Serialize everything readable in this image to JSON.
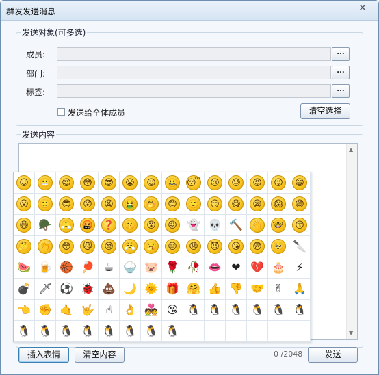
{
  "window": {
    "title": "群发发送消息",
    "close_glyph": "✕"
  },
  "recipients": {
    "group_title": "发送对象(可多选)",
    "members_label": "成员:",
    "departments_label": "部门:",
    "tags_label": "标签:",
    "browse_label": "...",
    "send_all_label": "发送给全体成员",
    "send_all_checked": false,
    "clear_selection_label": "清空选择"
  },
  "content": {
    "group_title": "发送内容",
    "value": ""
  },
  "emoji_panel": {
    "items": [
      {
        "name": "smile-emoji",
        "kind": "smiley",
        "glyph": "☺"
      },
      {
        "name": "grimace-emoji",
        "kind": "smiley",
        "glyph": "😬"
      },
      {
        "name": "heart-eyes-emoji",
        "kind": "smiley",
        "glyph": "😍"
      },
      {
        "name": "stare-emoji",
        "kind": "smiley",
        "glyph": "😳"
      },
      {
        "name": "sunglasses-emoji",
        "kind": "smiley",
        "glyph": "😎"
      },
      {
        "name": "cry-emoji",
        "kind": "smiley",
        "glyph": "😭"
      },
      {
        "name": "shy-emoji",
        "kind": "smiley",
        "glyph": "☺"
      },
      {
        "name": "shut-up-emoji",
        "kind": "smiley",
        "glyph": "🤐"
      },
      {
        "name": "sleep-emoji",
        "kind": "smiley",
        "glyph": "😴"
      },
      {
        "name": "tears-emoji",
        "kind": "smiley",
        "glyph": "😢"
      },
      {
        "name": "awkward-emoji",
        "kind": "smiley",
        "glyph": "😓"
      },
      {
        "name": "angry-emoji",
        "kind": "smiley",
        "glyph": "😡"
      },
      {
        "name": "tongue-emoji",
        "kind": "smiley",
        "glyph": "😜"
      },
      {
        "name": "grin-emoji",
        "kind": "smiley",
        "glyph": "😁"
      },
      {
        "name": "surprise-emoji",
        "kind": "smiley",
        "glyph": "😮"
      },
      {
        "name": "sad-emoji",
        "kind": "smiley",
        "glyph": "🙁"
      },
      {
        "name": "cool-emoji",
        "kind": "smiley",
        "glyph": "😎"
      },
      {
        "name": "cold-sweat-emoji",
        "kind": "smiley",
        "glyph": "😰"
      },
      {
        "name": "crazy-emoji",
        "kind": "smiley",
        "glyph": "😫"
      },
      {
        "name": "vomit-emoji",
        "kind": "smiley",
        "glyph": "🤮"
      },
      {
        "name": "chuckle-emoji",
        "kind": "smiley",
        "glyph": "🤭"
      },
      {
        "name": "joyful-emoji",
        "kind": "smiley",
        "glyph": "😊"
      },
      {
        "name": "slight-emoji",
        "kind": "smiley",
        "glyph": "🙂"
      },
      {
        "name": "proud-emoji",
        "kind": "smiley",
        "glyph": "😏"
      },
      {
        "name": "hungry-emoji",
        "kind": "smiley",
        "glyph": "😋"
      },
      {
        "name": "drowsy-emoji",
        "kind": "smiley",
        "glyph": "😪"
      },
      {
        "name": "panic-emoji",
        "kind": "smiley",
        "glyph": "😱"
      },
      {
        "name": "sweat-emoji",
        "kind": "smiley",
        "glyph": "😅"
      },
      {
        "name": "laugh-emoji",
        "kind": "smiley",
        "glyph": "😄"
      },
      {
        "name": "soldier-emoji",
        "kind": "obj",
        "glyph": "🪖"
      },
      {
        "name": "strive-emoji",
        "kind": "smiley",
        "glyph": "😤"
      },
      {
        "name": "curse-emoji",
        "kind": "smiley",
        "glyph": "🤬"
      },
      {
        "name": "question-emoji",
        "kind": "smiley",
        "glyph": "❓"
      },
      {
        "name": "shh-emoji",
        "kind": "smiley",
        "glyph": "🤫"
      },
      {
        "name": "dizzy-emoji",
        "kind": "smiley",
        "glyph": "😵"
      },
      {
        "name": "tormented-emoji",
        "kind": "smiley",
        "glyph": "😖"
      },
      {
        "name": "skeleton-emoji",
        "kind": "obj",
        "glyph": "👻"
      },
      {
        "name": "skull-emoji",
        "kind": "obj",
        "glyph": "💀"
      },
      {
        "name": "hammer-emoji",
        "kind": "obj",
        "glyph": "🔨"
      },
      {
        "name": "bye-emoji",
        "kind": "smiley",
        "glyph": "👋"
      },
      {
        "name": "glasses-emoji",
        "kind": "smiley",
        "glyph": "🤓"
      },
      {
        "name": "kiss-emoji",
        "kind": "smiley",
        "glyph": "😚"
      },
      {
        "name": "pick-nose-emoji",
        "kind": "smiley",
        "glyph": "🤔"
      },
      {
        "name": "applause-emoji",
        "kind": "smiley",
        "glyph": "👏"
      },
      {
        "name": "embarrassed-emoji",
        "kind": "smiley",
        "glyph": "😳"
      },
      {
        "name": "snicker-emoji",
        "kind": "smiley",
        "glyph": "😼"
      },
      {
        "name": "left-humph-emoji",
        "kind": "smiley",
        "glyph": "😒"
      },
      {
        "name": "right-humph-emoji",
        "kind": "smiley",
        "glyph": "😤"
      },
      {
        "name": "yawn-emoji",
        "kind": "smiley",
        "glyph": "🥱"
      },
      {
        "name": "pooh-pooh-emoji",
        "kind": "smiley",
        "glyph": "😑"
      },
      {
        "name": "grievance-emoji",
        "kind": "smiley",
        "glyph": "😞"
      },
      {
        "name": "sly-emoji",
        "kind": "smiley",
        "glyph": "😈"
      },
      {
        "name": "kiss-face-emoji",
        "kind": "smiley",
        "glyph": "😘"
      },
      {
        "name": "scared-emoji",
        "kind": "smiley",
        "glyph": "😨"
      },
      {
        "name": "pitiful-emoji",
        "kind": "smiley",
        "glyph": "🥺"
      },
      {
        "name": "cleaver-emoji",
        "kind": "obj",
        "glyph": "🔪"
      },
      {
        "name": "watermelon-emoji",
        "kind": "obj",
        "glyph": "🍉"
      },
      {
        "name": "beer-emoji",
        "kind": "obj",
        "glyph": "🍺"
      },
      {
        "name": "basketball-emoji",
        "kind": "obj",
        "glyph": "🏀"
      },
      {
        "name": "ping-pong-emoji",
        "kind": "obj",
        "glyph": "🏓"
      },
      {
        "name": "coffee-emoji",
        "kind": "obj",
        "glyph": "☕"
      },
      {
        "name": "rice-emoji",
        "kind": "obj",
        "glyph": "🍚"
      },
      {
        "name": "pig-emoji",
        "kind": "obj",
        "glyph": "🐷"
      },
      {
        "name": "rose-emoji",
        "kind": "obj",
        "glyph": "🌹"
      },
      {
        "name": "wilt-emoji",
        "kind": "obj",
        "glyph": "🥀"
      },
      {
        "name": "lips-emoji",
        "kind": "obj",
        "glyph": "👄"
      },
      {
        "name": "heart-emoji",
        "kind": "obj",
        "glyph": "❤"
      },
      {
        "name": "heartbreak-emoji",
        "kind": "obj",
        "glyph": "💔"
      },
      {
        "name": "cake-emoji",
        "kind": "obj",
        "glyph": "🎂"
      },
      {
        "name": "lightning-emoji",
        "kind": "obj",
        "glyph": "⚡"
      },
      {
        "name": "bomb-emoji",
        "kind": "obj",
        "glyph": "💣"
      },
      {
        "name": "dagger-emoji",
        "kind": "obj",
        "glyph": "🗡"
      },
      {
        "name": "soccer-emoji",
        "kind": "obj",
        "glyph": "⚽"
      },
      {
        "name": "ladybug-emoji",
        "kind": "obj",
        "glyph": "🐞"
      },
      {
        "name": "poop-emoji",
        "kind": "obj",
        "glyph": "💩"
      },
      {
        "name": "moon-emoji",
        "kind": "obj",
        "glyph": "🌙"
      },
      {
        "name": "sun-emoji",
        "kind": "obj",
        "glyph": "🌞"
      },
      {
        "name": "gift-emoji",
        "kind": "obj",
        "glyph": "🎁"
      },
      {
        "name": "hug-emoji",
        "kind": "obj",
        "glyph": "🤗"
      },
      {
        "name": "thumbs-up-emoji",
        "kind": "obj",
        "glyph": "👍"
      },
      {
        "name": "thumbs-down-emoji",
        "kind": "obj",
        "glyph": "👎"
      },
      {
        "name": "handshake-emoji",
        "kind": "obj",
        "glyph": "🤝"
      },
      {
        "name": "victory-emoji",
        "kind": "obj",
        "glyph": "✌"
      },
      {
        "name": "salute-emoji",
        "kind": "obj",
        "glyph": "🙏"
      },
      {
        "name": "beckon-emoji",
        "kind": "obj",
        "glyph": "👈"
      },
      {
        "name": "fist-emoji",
        "kind": "obj",
        "glyph": "✊"
      },
      {
        "name": "pinky-emoji",
        "kind": "obj",
        "glyph": "🤙"
      },
      {
        "name": "love-you-emoji",
        "kind": "obj",
        "glyph": "🤟"
      },
      {
        "name": "no-emoji",
        "kind": "obj",
        "glyph": "☝"
      },
      {
        "name": "ok-emoji",
        "kind": "obj",
        "glyph": "👌"
      },
      {
        "name": "couple-emoji",
        "kind": "obj",
        "glyph": "💑"
      },
      {
        "name": "flying-kiss-emoji",
        "kind": "obj",
        "glyph": "😘"
      },
      {
        "name": "penguin-jump-emoji",
        "kind": "obj",
        "glyph": "🐧"
      },
      {
        "name": "penguin-shiver-emoji",
        "kind": "obj",
        "glyph": "🐧"
      },
      {
        "name": "penguin-wave-emoji",
        "kind": "obj",
        "glyph": "🐧"
      },
      {
        "name": "penguin-turn-emoji",
        "kind": "obj",
        "glyph": "🐧"
      },
      {
        "name": "penguin-bow-emoji",
        "kind": "obj",
        "glyph": "🐧"
      },
      {
        "name": "penguin-hi-emoji",
        "kind": "obj",
        "glyph": "🐧"
      },
      {
        "name": "penguin-yawn-emoji",
        "kind": "obj",
        "glyph": "🐧"
      },
      {
        "name": "penguin-dance-emoji",
        "kind": "obj",
        "glyph": "🐧"
      },
      {
        "name": "penguin-kotow-emoji",
        "kind": "obj",
        "glyph": "🐧"
      },
      {
        "name": "penguin-hop-emoji",
        "kind": "obj",
        "glyph": "🐧"
      },
      {
        "name": "penguin-fight-emoji",
        "kind": "obj",
        "glyph": "🐧"
      },
      {
        "name": "penguin-cheer-emoji",
        "kind": "obj",
        "glyph": "🐧"
      },
      {
        "name": "penguin-love-emoji",
        "kind": "obj",
        "glyph": "🐧"
      },
      {
        "name": "penguin-sway-emoji",
        "kind": "obj",
        "glyph": "🐧"
      }
    ]
  },
  "footer": {
    "insert_emoji_label": "插入表情",
    "clear_content_label": "清空内容",
    "char_count": "0 /2048",
    "send_label": "发送"
  }
}
